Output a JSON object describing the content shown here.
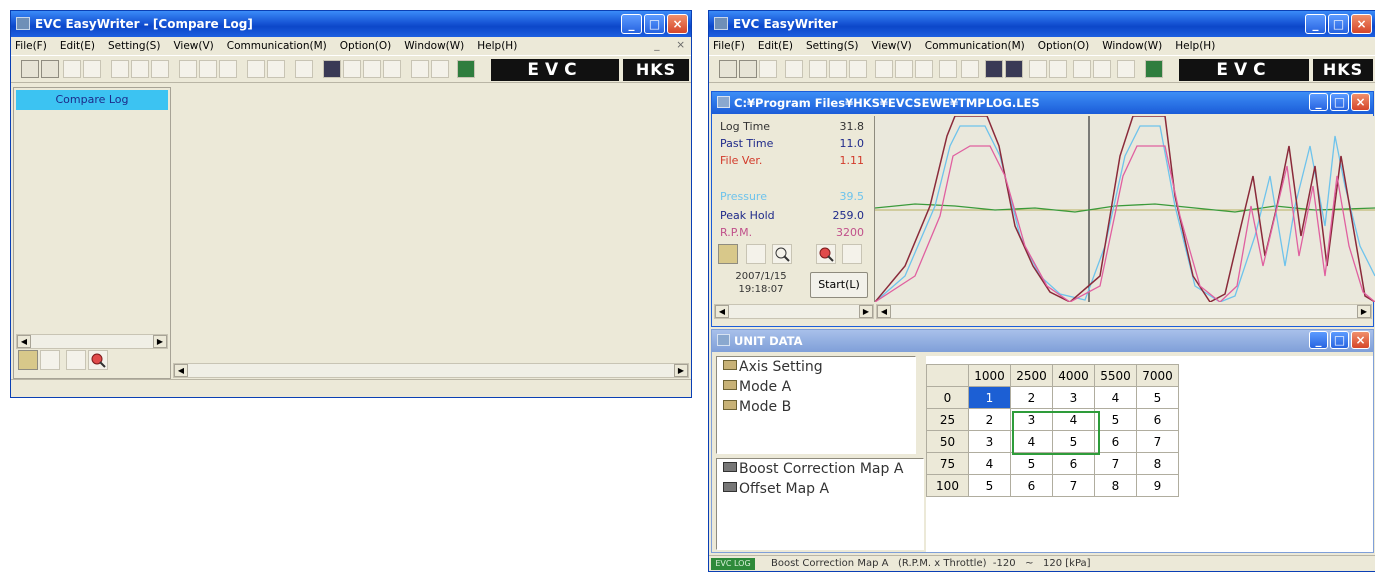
{
  "left_window": {
    "title": "EVC EasyWriter - [Compare Log]",
    "menu": [
      "File(F)",
      "Edit(E)",
      "Setting(S)",
      "View(V)",
      "Communication(M)",
      "Option(O)",
      "Window(W)",
      "Help(H)"
    ],
    "mdi_controls": "_     ×",
    "sidebar_tab": "Compare Log",
    "logo_evc": "EVC",
    "logo_hks": "HKS"
  },
  "right_window": {
    "title": "EVC EasyWriter",
    "menu": [
      "File(F)",
      "Edit(E)",
      "Setting(S)",
      "View(V)",
      "Communication(M)",
      "Option(O)",
      "Window(W)",
      "Help(H)"
    ],
    "logo_evc": "EVC",
    "logo_hks": "HKS",
    "log_window": {
      "title": "C:¥Program Files¥HKS¥EVCSEWE¥TMPLOG.LES",
      "stats": [
        {
          "label": "Log Time",
          "value": "31.8",
          "color": "#333333"
        },
        {
          "label": "Past Time",
          "value": "11.0",
          "color": "#1f2a8a"
        },
        {
          "label": "File Ver.",
          "value": "1.11",
          "color": "#d23a2a"
        },
        {
          "label": "Pressure",
          "value": "39.5",
          "color": "#6ec3ec"
        },
        {
          "label": "Peak Hold",
          "value": "259.0",
          "color": "#1f2a8a"
        },
        {
          "label": "R.P.M.",
          "value": "3200",
          "color": "#c0508a"
        }
      ],
      "date": "2007/1/15",
      "time": "19:18:07",
      "start_label": "Start(L)"
    },
    "unit_data": {
      "title": "UNIT DATA",
      "tree_top": [
        "Axis Setting",
        "Mode A",
        "Mode B"
      ],
      "tree_bottom": [
        "Boost Correction Map A",
        "Offset Map A"
      ],
      "col_headers": [
        "1000",
        "2500",
        "4000",
        "5500",
        "7000"
      ],
      "rows": [
        {
          "label": "0",
          "cells": [
            "1",
            "2",
            "3",
            "4",
            "5"
          ]
        },
        {
          "label": "25",
          "cells": [
            "2",
            "3",
            "4",
            "5",
            "6"
          ]
        },
        {
          "label": "50",
          "cells": [
            "3",
            "4",
            "5",
            "6",
            "7"
          ]
        },
        {
          "label": "75",
          "cells": [
            "4",
            "5",
            "6",
            "7",
            "8"
          ]
        },
        {
          "label": "100",
          "cells": [
            "5",
            "6",
            "7",
            "8",
            "9"
          ]
        }
      ]
    },
    "status": {
      "badge": "EVC LOG",
      "text": "Boost Correction Map A   (R.P.M. x Throttle)  -120   ~   120 [kPa]"
    }
  },
  "colors": {
    "title_blue": "#1756d6",
    "pressure": "#6ec3ec",
    "peak_hold": "#8a2a3a",
    "rpm": "#e060a0",
    "throttle": "#3a9a3a",
    "select": "#1c5fd4",
    "highlight_box": "#2e9c3a"
  },
  "icons": [
    "open-folder-icon",
    "save-icon",
    "zoom-out-icon",
    "zoom-in-icon",
    "chart-icon"
  ]
}
